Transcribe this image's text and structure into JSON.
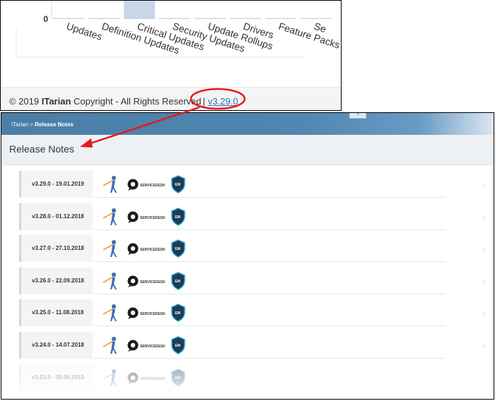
{
  "dashboard": {
    "chart_data": {
      "type": "bar",
      "categories": [
        "Updates",
        "Definition Updates",
        "Critical Updates",
        "Security Updates",
        "Update Rollups",
        "Drivers",
        "Feature Packs",
        "Se"
      ],
      "values": [
        0,
        0,
        1,
        0,
        0,
        0,
        0,
        0
      ],
      "y_tick_visible": "0"
    },
    "footer": {
      "copyright_prefix": "© 2019 ",
      "brand": "ITarian",
      "copyright_suffix": " Copyright - All Rights Reserved",
      "separator": "|",
      "version_link": "v3.29.0"
    }
  },
  "release_notes_page": {
    "breadcrumb": {
      "root": "ITarian",
      "separator": ">",
      "current": "Release Notes"
    },
    "title": "Release Notes",
    "product_icons": [
      "itarian-icon",
      "service-desk-icon",
      "endpoint-manager-icon"
    ],
    "service_desk_label": "SERVICEDESK",
    "em_label": "EM",
    "releases": [
      {
        "label": "v3.29.0 - 19.01.2019"
      },
      {
        "label": "v3.28.0 - 01.12.2018"
      },
      {
        "label": "v3.27.0 - 27.10.2018"
      },
      {
        "label": "v3.26.0 - 22.09.2018"
      },
      {
        "label": "v3.25.0 - 11.08.2018"
      },
      {
        "label": "v3.24.0 - 14.07.2018"
      },
      {
        "label": "v3.23.0 - 09.06.2018"
      }
    ]
  },
  "colors": {
    "annotation": "#e31b1b",
    "header_blue": "#4f86b2",
    "link": "#2a6db0",
    "bar_fill": "#c7d7e6"
  }
}
